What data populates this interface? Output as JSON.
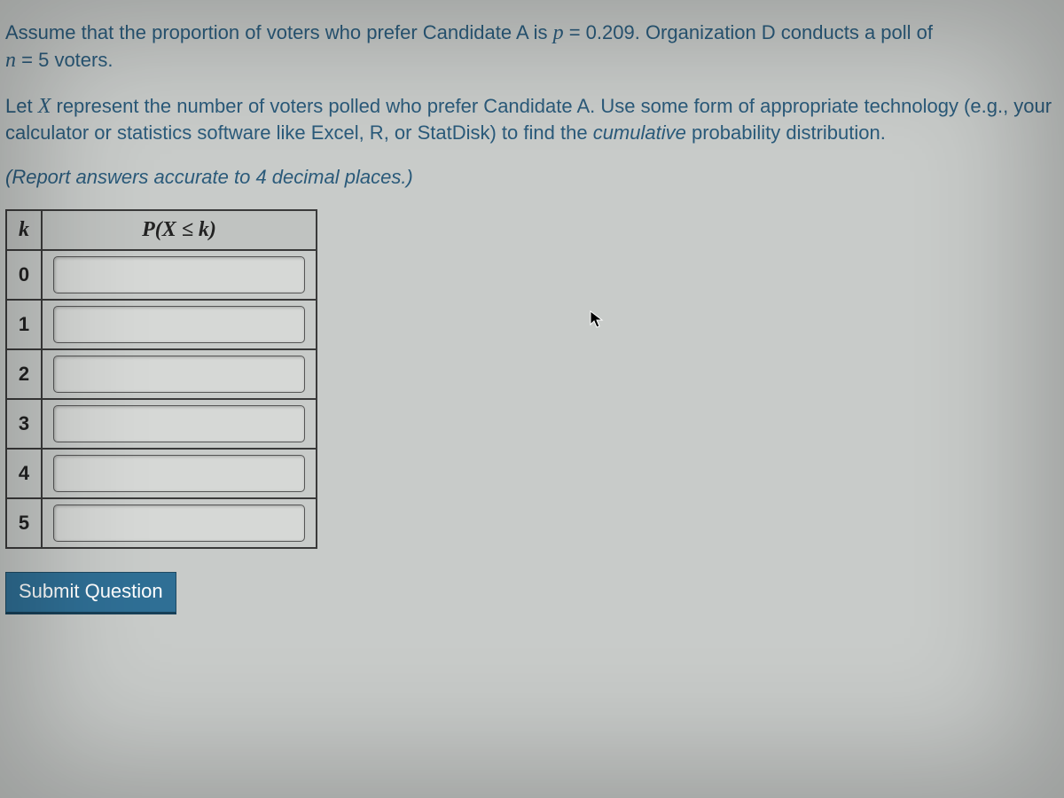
{
  "question": {
    "p1_a": "Assume that the proportion of voters who prefer Candidate A is ",
    "p1_var_p": "p",
    "p1_eq": " = ",
    "p1_pval": "0.209",
    "p1_b": ".  Organization D conducts a poll of ",
    "p1_var_n": "n",
    "p1_nval": "5",
    "p1_c": " voters.",
    "p2_a": "Let ",
    "p2_var_x": "X",
    "p2_b": " represent the number of voters polled who prefer Candidate A.  Use some form of appropriate technology (e.g., your calculator or statistics software like Excel, R, or StatDisk) to find the ",
    "p2_cum": "cumulative",
    "p2_c": " probability distribution.",
    "p3": "(Report answers accurate to 4 decimal places.)"
  },
  "table": {
    "header_k": "k",
    "header_p": "P(X ≤ k)",
    "rows": [
      {
        "k": "0",
        "value": ""
      },
      {
        "k": "1",
        "value": ""
      },
      {
        "k": "2",
        "value": ""
      },
      {
        "k": "3",
        "value": ""
      },
      {
        "k": "4",
        "value": ""
      },
      {
        "k": "5",
        "value": ""
      }
    ]
  },
  "submit_label": "Submit Question"
}
